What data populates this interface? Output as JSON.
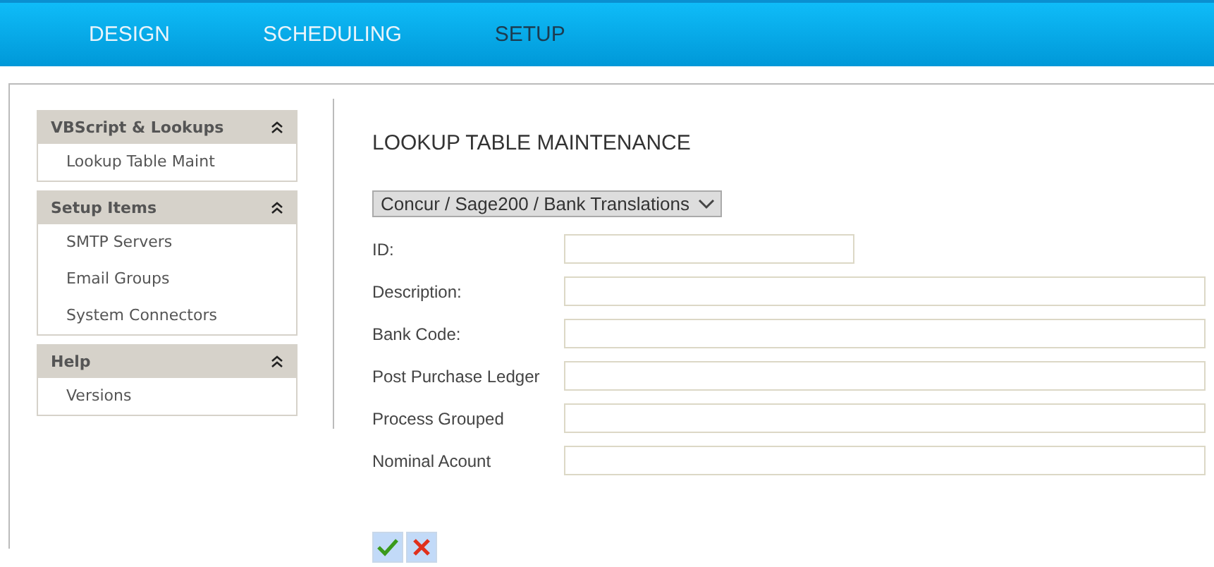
{
  "nav": [
    {
      "label": "DESIGN",
      "selected": false
    },
    {
      "label": "SCHEDULING",
      "selected": false
    },
    {
      "label": "SETUP",
      "selected": true
    }
  ],
  "sidebar": [
    {
      "title": "VBScript & Lookups",
      "expanded": true,
      "items": [
        "Lookup Table Maint"
      ]
    },
    {
      "title": "Setup Items",
      "expanded": true,
      "items": [
        "SMTP Servers",
        "Email Groups",
        "System Connectors"
      ]
    },
    {
      "title": "Help",
      "expanded": true,
      "items": [
        "Versions"
      ]
    }
  ],
  "page_title": "LOOKUP TABLE MAINTENANCE",
  "table_select": "Concur / Sage200 / Bank Translations",
  "fields": [
    {
      "label": "ID:",
      "kind": "short"
    },
    {
      "label": "Description:",
      "kind": "wide"
    },
    {
      "label": "Bank Code:",
      "kind": "wide"
    },
    {
      "label": "Post Purchase Ledger",
      "kind": "wide"
    },
    {
      "label": "Process Grouped",
      "kind": "wide"
    },
    {
      "label": "Nominal Acount",
      "kind": "wide"
    }
  ]
}
